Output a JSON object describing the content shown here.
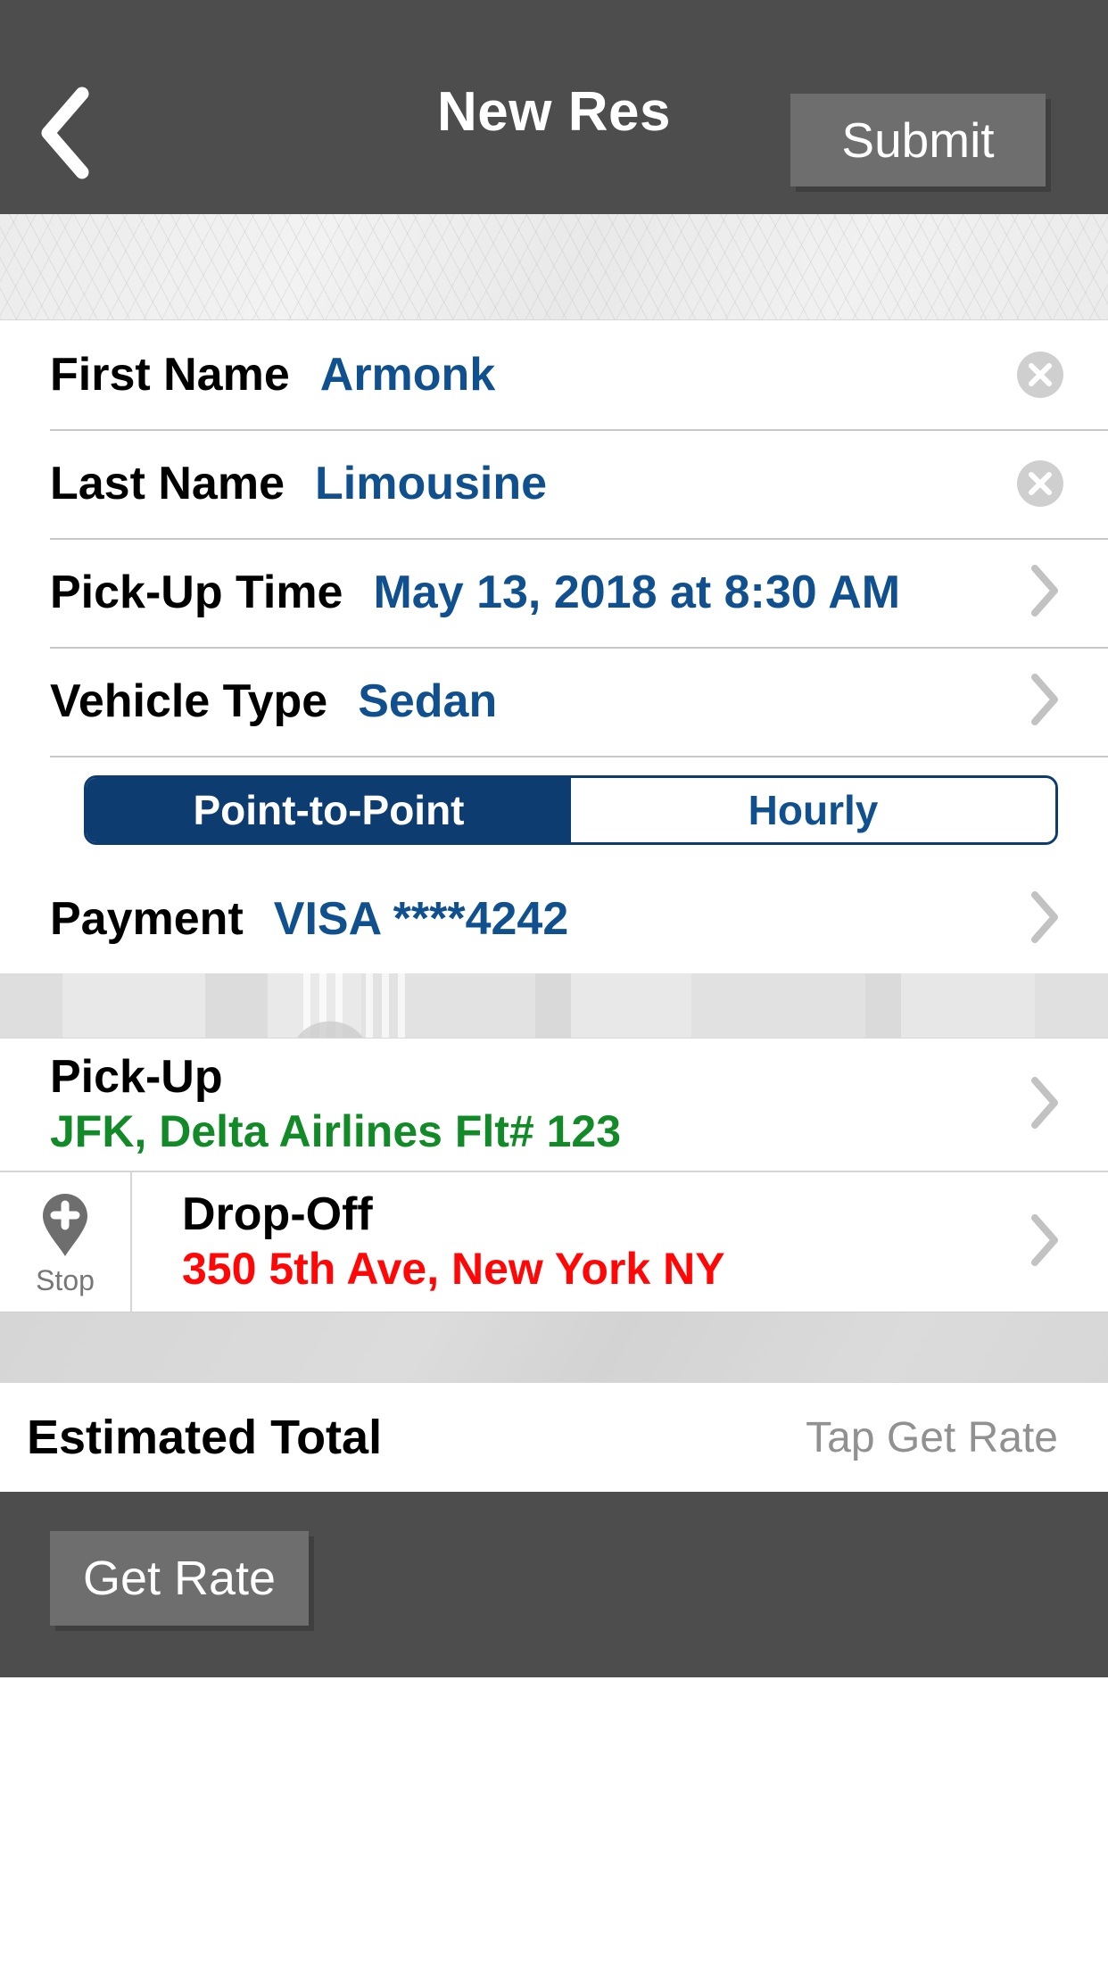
{
  "navbar": {
    "back_icon": "chevron-left-icon",
    "title": "New Res",
    "submit_label": "Submit"
  },
  "form": {
    "rows": [
      {
        "label": "First Name",
        "value": "Armonk",
        "accessory": "clear"
      },
      {
        "label": "Last Name",
        "value": "Limousine",
        "accessory": "clear"
      },
      {
        "label": "Pick-Up Time",
        "value": "May 13, 2018 at 8:30 AM",
        "accessory": "chevron"
      },
      {
        "label": "Vehicle Type",
        "value": "Sedan",
        "accessory": "chevron"
      }
    ],
    "segmented": {
      "options": [
        "Point-to-Point",
        "Hourly"
      ],
      "selected": "Point-to-Point"
    },
    "payment": {
      "label": "Payment",
      "value": "VISA ****4242",
      "accessory": "chevron"
    }
  },
  "locations": {
    "pickup": {
      "title": "Pick-Up",
      "value": "JFK, Delta Airlines Flt# 123"
    },
    "stop": {
      "label": "Stop",
      "icon": "map-pin-plus-icon"
    },
    "dropoff": {
      "title": "Drop-Off",
      "value": "350 5th Ave, New York NY"
    }
  },
  "totals": {
    "label": "Estimated Total",
    "value": "Tap Get Rate"
  },
  "footer": {
    "get_rate_label": "Get Rate"
  },
  "colors": {
    "navbar_bg": "#4d4d4d",
    "button_bg": "#6e6e6e",
    "value_blue": "#11508f",
    "segment_navy": "#0d3d70",
    "pickup_green": "#128a28",
    "dropoff_red": "#ff0707",
    "muted_grey": "#919191"
  }
}
